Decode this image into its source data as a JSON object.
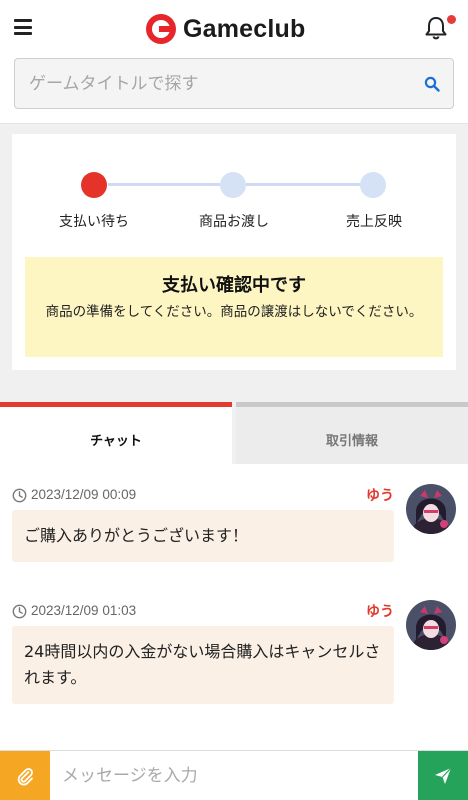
{
  "header": {
    "logo_text": "Gameclub",
    "search_placeholder": "ゲームタイトルで探す",
    "notification_badge": true
  },
  "status": {
    "steps": [
      {
        "label": "支払い待ち",
        "state": "active"
      },
      {
        "label": "商品お渡し",
        "state": "inactive"
      },
      {
        "label": "売上反映",
        "state": "inactive"
      }
    ],
    "notice_title": "支払い確認中です",
    "notice_body": "商品の準備をしてください。商品の譲渡はしないでください。"
  },
  "tabs": [
    {
      "label": "チャット",
      "selected": true
    },
    {
      "label": "取引情報",
      "selected": false
    }
  ],
  "messages": [
    {
      "time": "2023/12/09 00:09",
      "sender": "ゆう",
      "text": "ご購入ありがとうございます！"
    },
    {
      "time": "2023/12/09 01:03",
      "sender": "ゆう",
      "text": "24時間以内の入金がない場合購入はキャンセルされます。"
    }
  ],
  "composer": {
    "placeholder": "メッセージを入力"
  },
  "colors": {
    "brand": "#e7262b",
    "step_active": "#e5332a",
    "step_inactive": "#d5e1f5",
    "notice_bg": "#fdf6c3",
    "bubble_bg": "#faf0e6",
    "attach_button": "#f5a623",
    "send_button": "#26a35a"
  },
  "icons": {
    "menu": "hamburger-icon",
    "bell": "bell-icon",
    "search": "search-icon",
    "clock": "clock-icon",
    "attach": "paperclip-icon",
    "send": "paper-plane-icon"
  }
}
